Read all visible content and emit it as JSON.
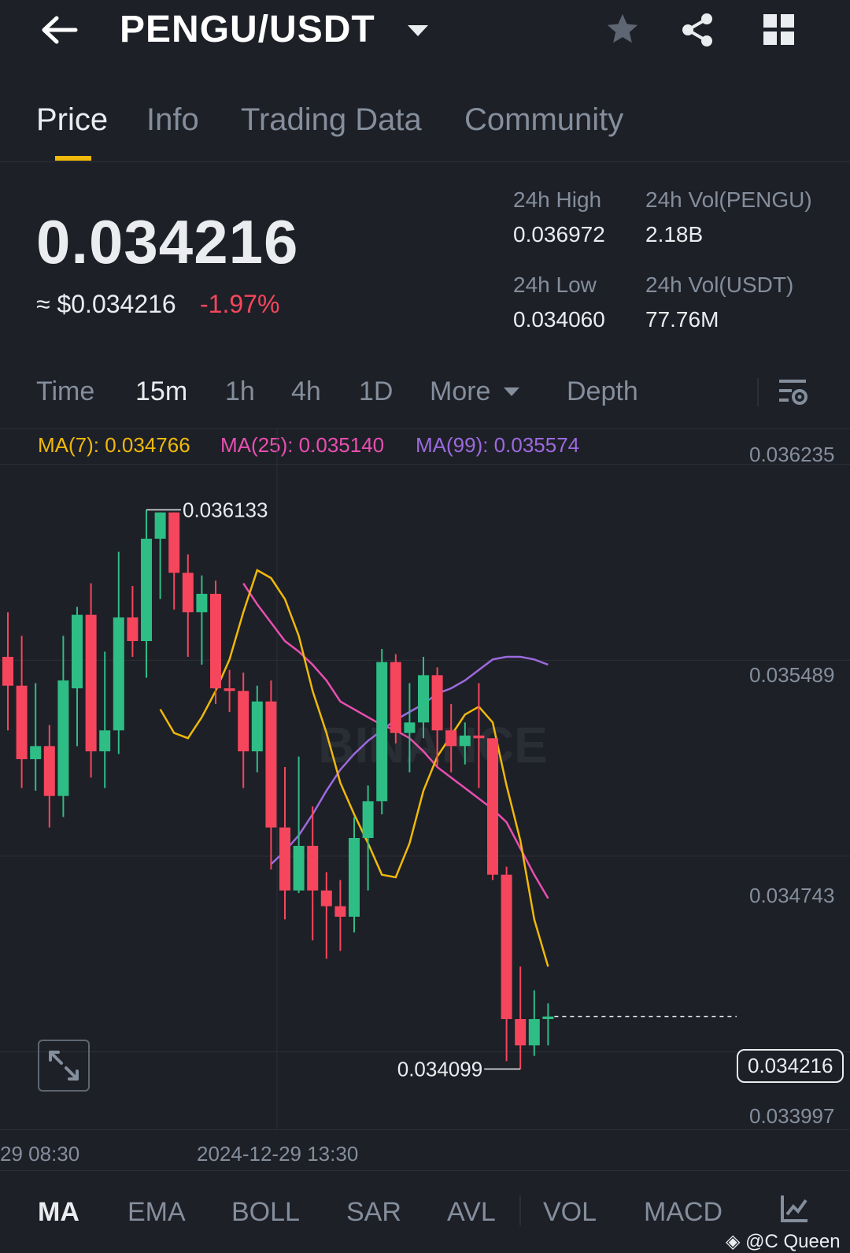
{
  "header": {
    "pair": "PENGU/USDT",
    "icons": [
      "back-arrow-icon",
      "dropdown-caret-icon",
      "star-icon",
      "share-icon",
      "grid-icon"
    ]
  },
  "tabs": [
    "Price",
    "Info",
    "Trading Data",
    "Community"
  ],
  "active_tab": "Price",
  "price": {
    "last": "0.034216",
    "usd": "≈ $0.034216",
    "change": "-1.97%"
  },
  "stats": {
    "high_label": "24h High",
    "high_value": "0.036972",
    "low_label": "24h Low",
    "low_value": "0.034060",
    "vol_base_label": "24h Vol(PENGU)",
    "vol_base_value": "2.18B",
    "vol_quote_label": "24h Vol(USDT)",
    "vol_quote_value": "77.76M"
  },
  "intervals": [
    "Time",
    "15m",
    "1h",
    "4h",
    "1D",
    "More",
    "Depth"
  ],
  "active_interval": "15m",
  "ma_legend": {
    "ma7": "MA(7): 0.034766",
    "ma25": "MA(25): 0.035140",
    "ma99": "MA(99): 0.035574"
  },
  "chart": {
    "y_labels": [
      "0.036235",
      "0.035489",
      "0.034743",
      "0.033997"
    ],
    "x_labels": [
      "29 08:30",
      "2024-12-29 13:30"
    ],
    "high_marker": "0.036133",
    "low_marker": "0.034099",
    "last_price_tag": "0.034216",
    "watermark": "BINANCE"
  },
  "indicators": [
    "MA",
    "EMA",
    "BOLL",
    "SAR",
    "AVL",
    "VOL",
    "MACD"
  ],
  "active_indicator": "MA",
  "credit": "@C Queen",
  "colors": {
    "background": "#1e2027",
    "up": "#2ebd85",
    "down": "#f6465d",
    "accent": "#f0b90b",
    "ma7": "#f0b90b",
    "ma25": "#e84fb1",
    "ma99": "#9c6ade",
    "muted": "#848e9c"
  },
  "chart_data": {
    "type": "candlestick",
    "interval": "15m",
    "y_range": [
      0.0339,
      0.03633
    ],
    "candles": [
      {
        "o": 0.03558,
        "h": 0.03575,
        "l": 0.0353,
        "c": 0.03547
      },
      {
        "o": 0.03547,
        "h": 0.03566,
        "l": 0.03508,
        "c": 0.03519
      },
      {
        "o": 0.03519,
        "h": 0.03548,
        "l": 0.03507,
        "c": 0.03524
      },
      {
        "o": 0.03524,
        "h": 0.03532,
        "l": 0.03493,
        "c": 0.03505
      },
      {
        "o": 0.03505,
        "h": 0.03566,
        "l": 0.03497,
        "c": 0.03549
      },
      {
        "o": 0.03546,
        "h": 0.03577,
        "l": 0.03524,
        "c": 0.03574
      },
      {
        "o": 0.03574,
        "h": 0.03586,
        "l": 0.03512,
        "c": 0.03522
      },
      {
        "o": 0.03522,
        "h": 0.0356,
        "l": 0.03508,
        "c": 0.0353
      },
      {
        "o": 0.0353,
        "h": 0.03598,
        "l": 0.03521,
        "c": 0.03573
      },
      {
        "o": 0.03573,
        "h": 0.03585,
        "l": 0.03558,
        "c": 0.03564
      },
      {
        "o": 0.03564,
        "h": 0.03614,
        "l": 0.0355,
        "c": 0.03603
      },
      {
        "o": 0.03603,
        "h": 0.03613,
        "l": 0.0358,
        "c": 0.03613
      },
      {
        "o": 0.03613,
        "h": 0.03613,
        "l": 0.03576,
        "c": 0.0359
      },
      {
        "o": 0.0359,
        "h": 0.03597,
        "l": 0.03558,
        "c": 0.03575
      },
      {
        "o": 0.03575,
        "h": 0.03589,
        "l": 0.03555,
        "c": 0.03582
      },
      {
        "o": 0.03582,
        "h": 0.03587,
        "l": 0.0354,
        "c": 0.03546
      },
      {
        "o": 0.03546,
        "h": 0.03553,
        "l": 0.03537,
        "c": 0.03545
      },
      {
        "o": 0.03545,
        "h": 0.03552,
        "l": 0.03508,
        "c": 0.03522
      },
      {
        "o": 0.03522,
        "h": 0.03547,
        "l": 0.03514,
        "c": 0.03541
      },
      {
        "o": 0.03541,
        "h": 0.03549,
        "l": 0.03477,
        "c": 0.03493
      },
      {
        "o": 0.03493,
        "h": 0.03516,
        "l": 0.03458,
        "c": 0.03469
      },
      {
        "o": 0.03469,
        "h": 0.0352,
        "l": 0.03468,
        "c": 0.03486
      },
      {
        "o": 0.03486,
        "h": 0.03501,
        "l": 0.0345,
        "c": 0.03469
      },
      {
        "o": 0.03469,
        "h": 0.03476,
        "l": 0.03443,
        "c": 0.03463
      },
      {
        "o": 0.03463,
        "h": 0.03473,
        "l": 0.03446,
        "c": 0.03459
      },
      {
        "o": 0.03459,
        "h": 0.03497,
        "l": 0.03453,
        "c": 0.03489
      },
      {
        "o": 0.03489,
        "h": 0.03509,
        "l": 0.03469,
        "c": 0.03503
      },
      {
        "o": 0.03503,
        "h": 0.03561,
        "l": 0.03498,
        "c": 0.03556
      },
      {
        "o": 0.03556,
        "h": 0.03559,
        "l": 0.03525,
        "c": 0.03529
      },
      {
        "o": 0.03529,
        "h": 0.03548,
        "l": 0.03514,
        "c": 0.03533
      },
      {
        "o": 0.03533,
        "h": 0.03558,
        "l": 0.03527,
        "c": 0.03551
      },
      {
        "o": 0.03551,
        "h": 0.03554,
        "l": 0.03516,
        "c": 0.0353
      },
      {
        "o": 0.0353,
        "h": 0.0354,
        "l": 0.03514,
        "c": 0.03524
      },
      {
        "o": 0.03524,
        "h": 0.03533,
        "l": 0.03517,
        "c": 0.03528
      },
      {
        "o": 0.03528,
        "h": 0.03548,
        "l": 0.03508,
        "c": 0.03527
      },
      {
        "o": 0.03527,
        "h": 0.03527,
        "l": 0.03473,
        "c": 0.03475
      },
      {
        "o": 0.03475,
        "h": 0.03478,
        "l": 0.03404,
        "c": 0.0342
      },
      {
        "o": 0.0342,
        "h": 0.0344,
        "l": 0.03401,
        "c": 0.0341
      },
      {
        "o": 0.0341,
        "h": 0.03431,
        "l": 0.03406,
        "c": 0.0342
      },
      {
        "o": 0.0342,
        "h": 0.03426,
        "l": 0.0341,
        "c": 0.03421
      }
    ],
    "ma7": [
      0.03538,
      0.03529,
      0.03527,
      0.03535,
      0.03545,
      0.03557,
      0.03575,
      0.03591,
      0.03588,
      0.0358,
      0.03566,
      0.03545,
      0.03529,
      0.0351,
      0.03498,
      0.03487,
      0.03475,
      0.03474,
      0.03487,
      0.03507,
      0.0352,
      0.03528,
      0.03536,
      0.03539,
      0.03533,
      0.03509,
      0.03488,
      0.03458,
      0.0344
    ],
    "ma25": [
      0.03586,
      0.03578,
      0.03571,
      0.03564,
      0.0356,
      0.03555,
      0.03549,
      0.03541,
      0.03538,
      0.03535,
      0.03532,
      0.0353,
      0.03527,
      0.03522,
      0.03516,
      0.03512,
      0.03508,
      0.03504,
      0.035,
      0.03495,
      0.03485,
      0.03475,
      0.03466
    ],
    "ma99": [
      0.03479,
      0.03484,
      0.0349,
      0.03498,
      0.03507,
      0.03515,
      0.03521,
      0.03526,
      0.0353,
      0.03534,
      0.03537,
      0.0354,
      0.03544,
      0.03546,
      0.03549,
      0.03553,
      0.03557,
      0.03558,
      0.03558,
      0.03557,
      0.03555
    ]
  }
}
